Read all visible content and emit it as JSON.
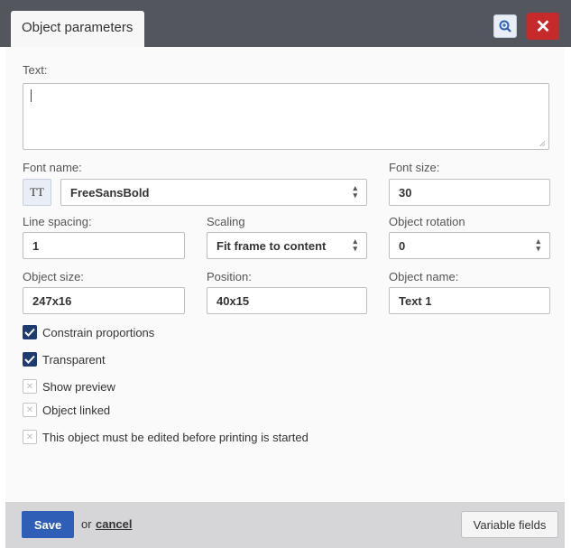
{
  "header": {
    "tab_title": "Object parameters",
    "zoom_icon": "zoom-in-icon",
    "close_icon": "close-icon"
  },
  "text_field": {
    "label": "Text:",
    "value": ""
  },
  "font_name": {
    "label": "Font name:",
    "value": "FreeSansBold",
    "style_button": "TT"
  },
  "font_size": {
    "label": "Font size:",
    "value": "30"
  },
  "line_spacing": {
    "label": "Line spacing:",
    "value": "1"
  },
  "scaling": {
    "label": "Scaling",
    "value": "Fit frame to content"
  },
  "object_rotation": {
    "label": "Object rotation",
    "value": "0"
  },
  "object_size": {
    "label": "Object size:",
    "value": "247x16"
  },
  "position": {
    "label": "Position:",
    "value": "40x15"
  },
  "object_name": {
    "label": "Object name:",
    "value": "Text 1"
  },
  "checkboxes": [
    {
      "label": "Constrain proportions",
      "checked": true
    },
    {
      "label": "Transparent",
      "checked": true
    },
    {
      "label": "Show preview",
      "checked": false
    },
    {
      "label": "Object linked",
      "checked": false
    },
    {
      "label": "This object must be edited before printing is started",
      "checked": false
    }
  ],
  "footer": {
    "save": "Save",
    "or": "or",
    "cancel": "cancel",
    "variable_fields": "Variable fields"
  },
  "colors": {
    "header_bg": "#53565d",
    "close_red": "#c72a2b",
    "save_blue": "#2f5eb6",
    "check_navy": "#1e3a6e"
  }
}
